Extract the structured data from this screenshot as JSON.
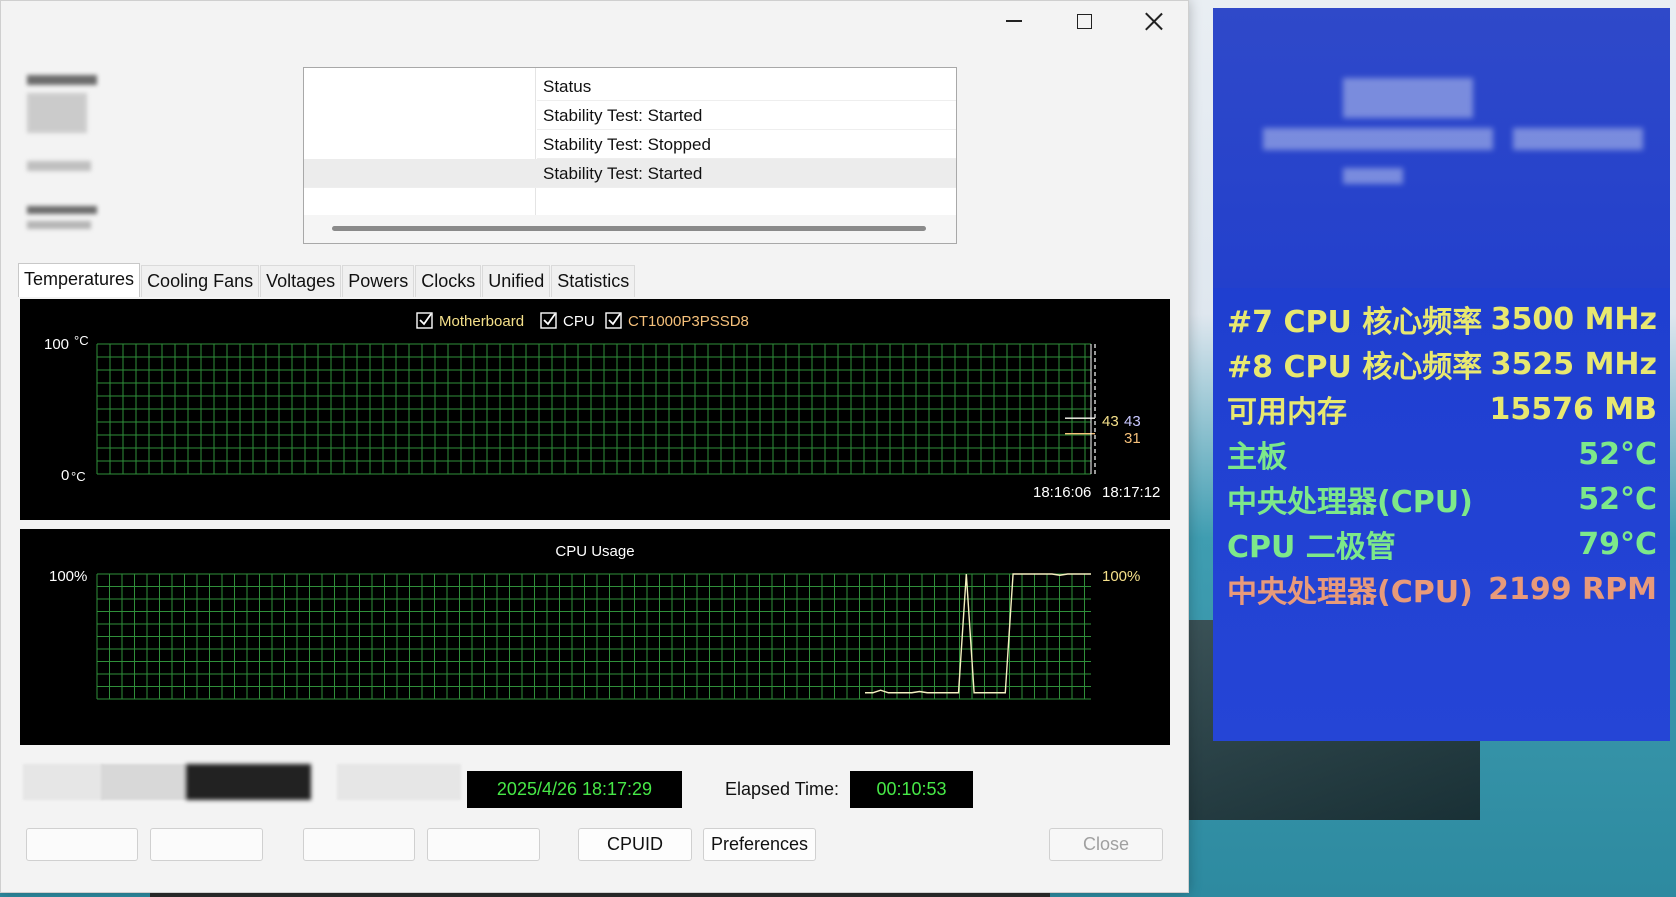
{
  "window": {
    "status_header": "Status",
    "status_rows": [
      {
        "text": "Stability Test: Started"
      },
      {
        "text": "Stability Test: Stopped"
      },
      {
        "text": "Stability Test: Started"
      }
    ],
    "tabs": [
      "Temperatures",
      "Cooling Fans",
      "Voltages",
      "Powers",
      "Clocks",
      "Unified",
      "Statistics"
    ],
    "active_tab": "Temperatures"
  },
  "temp_graph": {
    "legend": [
      {
        "label": "Motherboard",
        "checked": true,
        "color": "#f5e08a"
      },
      {
        "label": "CPU",
        "checked": true,
        "color": "#ffffff"
      },
      {
        "label": "CT1000P3PSSD8",
        "checked": true,
        "color": "#f5c07a"
      }
    ],
    "y_max_label": "100",
    "y_min_label": "0",
    "unit": "°C",
    "value_labels": [
      {
        "text": "43",
        "color": "#f5e08a"
      },
      {
        "text": "43",
        "color": "#c8c8ff"
      },
      {
        "text": "31",
        "color": "#f5c07a"
      }
    ],
    "time_start": "18:16:06",
    "time_end": "18:17:12"
  },
  "cpu_graph": {
    "title": "CPU Usage",
    "y_max_label": "100%",
    "current_label": "100%"
  },
  "chart_data": [
    {
      "type": "line",
      "series": [
        {
          "name": "Motherboard",
          "values": [
            43,
            43
          ]
        },
        {
          "name": "CPU",
          "values": [
            43,
            43
          ]
        },
        {
          "name": "CT1000P3PSSD8",
          "values": [
            31,
            31
          ]
        }
      ],
      "ylim": [
        0,
        100
      ],
      "x": [
        "18:16:06",
        "18:17:12"
      ]
    },
    {
      "type": "line",
      "title": "CPU Usage",
      "ylim": [
        0,
        100
      ],
      "values": [
        5,
        5,
        7,
        5,
        5,
        5,
        5,
        6,
        5,
        5,
        5,
        5,
        5,
        100,
        5,
        5,
        5,
        5,
        5,
        100,
        100,
        100,
        100,
        100,
        100,
        99,
        100,
        100,
        100,
        100
      ]
    }
  ],
  "footer": {
    "current_time": "2025/4/26 18:17:29",
    "elapsed_label": "Elapsed Time:",
    "elapsed_value": "00:10:53",
    "buttons": [
      "CPUID",
      "Preferences",
      "Close"
    ]
  },
  "osd": {
    "rows": [
      {
        "label": "#7 CPU 核心频率",
        "value": "3500 MHz",
        "color": "#e8e870"
      },
      {
        "label": "#8 CPU 核心频率",
        "value": "3525 MHz",
        "color": "#e8e870"
      },
      {
        "label": "可用内存",
        "value": "15576 MB",
        "color": "#e8e870"
      },
      {
        "label": "主板",
        "value": "52°C",
        "color": "#7de88a"
      },
      {
        "label": "中央处理器(CPU)",
        "value": "52°C",
        "color": "#7de88a"
      },
      {
        "label": "CPU 二极管",
        "value": "79°C",
        "color": "#7de88a"
      },
      {
        "label": "中央处理器(CPU)",
        "value": "2199 RPM",
        "color": "#e89a7a"
      }
    ]
  }
}
